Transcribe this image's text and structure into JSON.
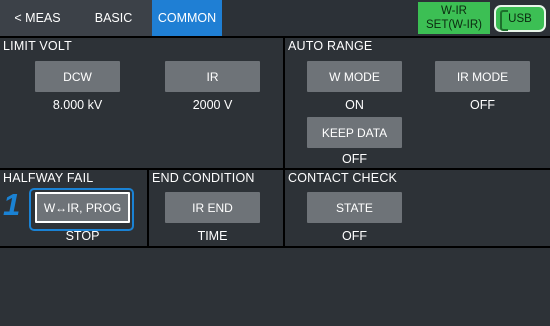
{
  "topbar": {
    "tabs": [
      {
        "label": "< MEAS",
        "active": false
      },
      {
        "label": "BASIC",
        "active": false
      },
      {
        "label": "COMMON",
        "active": true
      }
    ],
    "mode": {
      "line1": "W-IR",
      "line2": "SET(W-IR)"
    },
    "usb_label": "USB"
  },
  "limit_volt": {
    "title": "LIMIT VOLT",
    "dcw_button": "DCW",
    "dcw_value": "8.000 kV",
    "ir_button": "IR",
    "ir_value": "2000 V"
  },
  "auto_range": {
    "title": "AUTO RANGE",
    "wmode_button": "W MODE",
    "wmode_value": "ON",
    "irmode_button": "IR MODE",
    "irmode_value": "OFF",
    "keep_button": "KEEP DATA",
    "keep_value": "OFF"
  },
  "halfway_fail": {
    "title": "HALFWAY FAIL",
    "button": "W↔IR, PROG",
    "value": "STOP"
  },
  "end_condition": {
    "title": "END CONDITION",
    "button": "IR END",
    "value": "TIME"
  },
  "contact_check": {
    "title": "CONTACT CHECK",
    "button": "STATE",
    "value": "OFF"
  },
  "callout": {
    "number": "1"
  },
  "colors": {
    "background": "#000000",
    "panel": "#2d3237",
    "button": "#6e7378",
    "active_tab": "#1f7fd4",
    "status_green": "#3cbf54",
    "callout_blue": "#1a82d4"
  }
}
